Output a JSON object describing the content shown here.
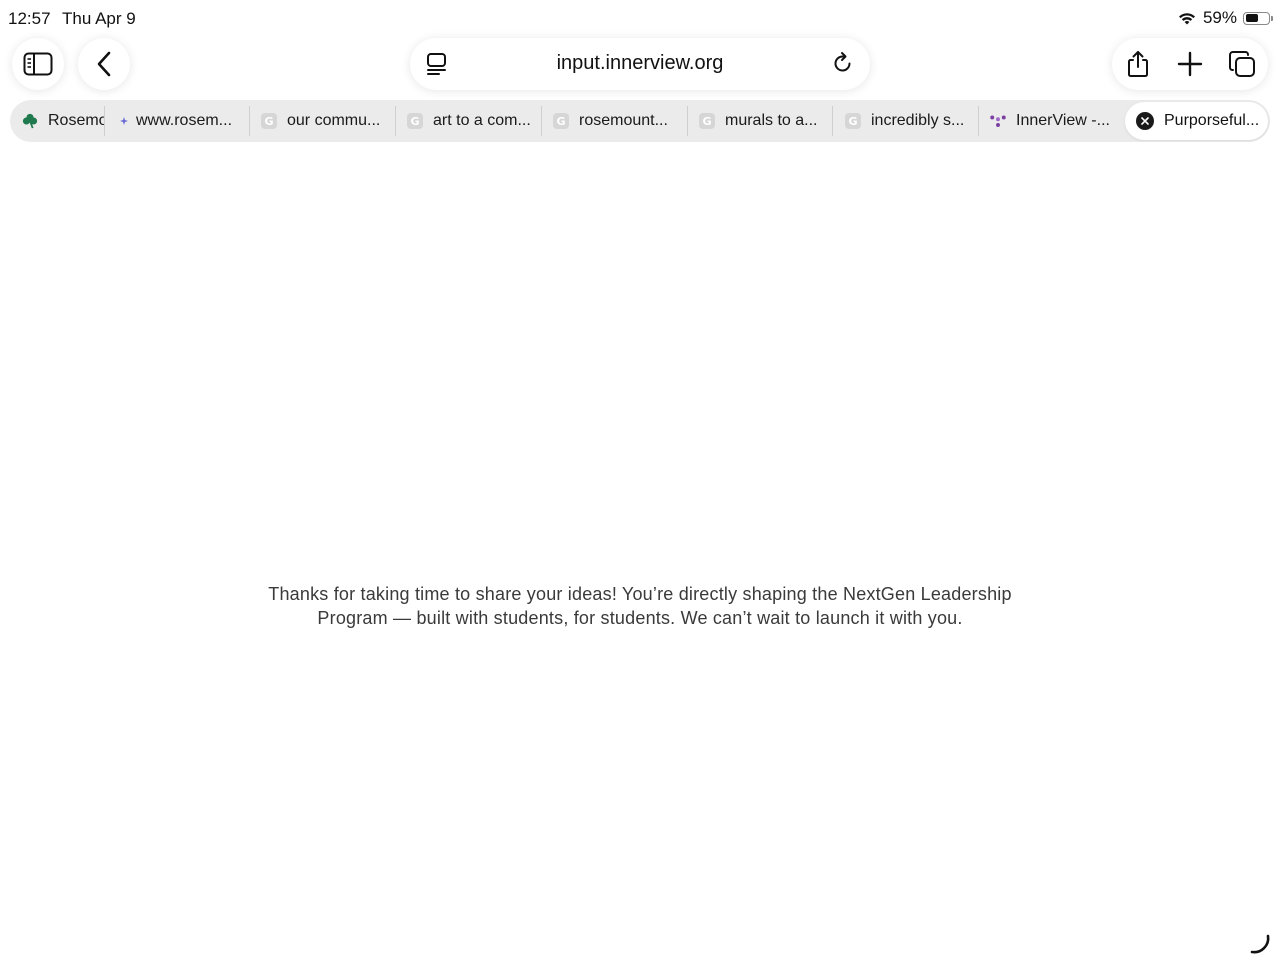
{
  "status_bar": {
    "time": "12:57",
    "date": "Thu Apr 9",
    "battery_percent": "59%",
    "battery_level": 0.59,
    "wifi_icon": "wifi-icon"
  },
  "toolbar": {
    "sidebar_icon": "sidebar-icon",
    "back_icon": "chevron-left-icon",
    "address": "input.innerview.org",
    "reader_icon": "reader-icon",
    "reload_icon": "reload-icon",
    "share_icon": "share-icon",
    "new_tab_icon": "plus-icon",
    "tabs_icon": "tabs-overview-icon"
  },
  "tabs": [
    {
      "label": "Rosemo",
      "favicon": "clover-icon"
    },
    {
      "label": "www.rosem...",
      "favicon": "star-icon"
    },
    {
      "label": "our commu...",
      "favicon": "G"
    },
    {
      "label": "art to a com...",
      "favicon": "G"
    },
    {
      "label": "rosemount...",
      "favicon": "G"
    },
    {
      "label": "murals to a...",
      "favicon": "G"
    },
    {
      "label": "incredibly s...",
      "favicon": "G"
    },
    {
      "label": "InnerView -...",
      "favicon": "innerview-icon"
    },
    {
      "label": "Purporseful...",
      "favicon": "close-icon",
      "active": true
    }
  ],
  "content": {
    "message": "Thanks for taking  time to share your ideas! You’re directly shaping the NextGen Leadership Program — built with students, for students. We can’t wait to launch it with you."
  },
  "colors": {
    "tab_strip_bg": "#ebebeb",
    "accent_green": "#1f7a4d",
    "innerview_purple": "#7a3fa0",
    "text": "#3a3a3a"
  }
}
